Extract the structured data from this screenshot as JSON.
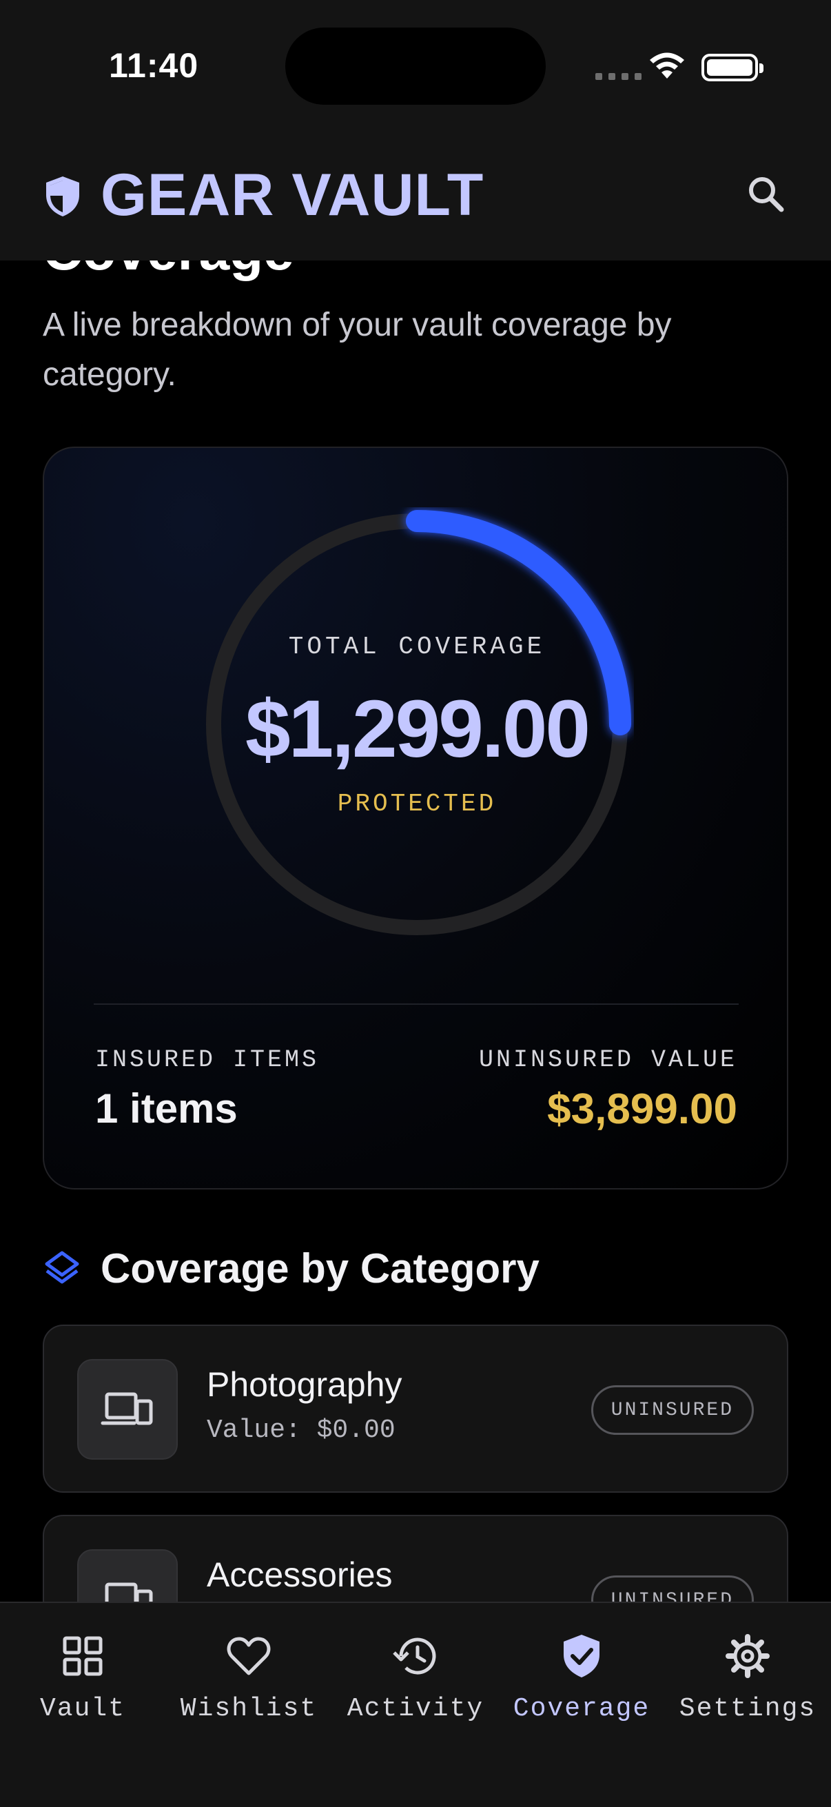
{
  "status_bar": {
    "time": "11:40"
  },
  "header": {
    "title": "GEAR VAULT",
    "brand_icon": "shield-icon",
    "search_icon": "search-icon"
  },
  "page": {
    "title": "Coverage",
    "subtitle": "A live breakdown of your vault coverage by category."
  },
  "summary": {
    "ring_label": "TOTAL COVERAGE",
    "total_value": "$1,299.00",
    "status": "PROTECTED",
    "coverage_fraction": 0.25,
    "insured_label": "INSURED ITEMS",
    "insured_value": "1 items",
    "uninsured_label": "UNINSURED VALUE",
    "uninsured_value": "$3,899.00"
  },
  "categories_section": {
    "title": "Coverage by Category",
    "icon": "layers-icon",
    "items": [
      {
        "name": "Photography",
        "value": "Value: $0.00",
        "badge": "UNINSURED",
        "icon": "devices-icon"
      },
      {
        "name": "Accessories",
        "value": "",
        "badge": "UNINSURED",
        "icon": "devices-icon"
      }
    ]
  },
  "tabbar": {
    "tabs": [
      {
        "label": "Vault",
        "icon": "grid-icon",
        "active": false
      },
      {
        "label": "Wishlist",
        "icon": "heart-icon",
        "active": false
      },
      {
        "label": "Activity",
        "icon": "history-icon",
        "active": false
      },
      {
        "label": "Coverage",
        "icon": "shield-check-icon",
        "active": true
      },
      {
        "label": "Settings",
        "icon": "gear-icon",
        "active": false
      }
    ]
  },
  "colors": {
    "accent": "#c3c7ff",
    "ring_progress": "#2f5bff",
    "gold": "#e5be4f",
    "background": "#000000",
    "surface": "#141414"
  }
}
